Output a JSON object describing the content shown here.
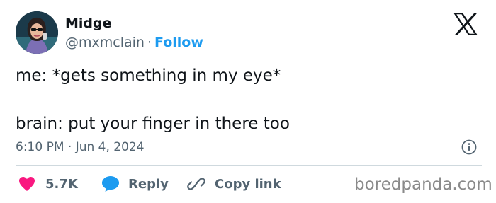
{
  "author": {
    "display_name": "Midge",
    "handle": "@mxmclain",
    "separator": "·",
    "follow_label": "Follow"
  },
  "tweet": {
    "text": "me: *gets something in my eye*\n\nbrain: put your finger in there too",
    "timestamp": "6:10 PM · Jun 4, 2024"
  },
  "actions": {
    "like_count": "5.7K",
    "reply_label": "Reply",
    "copy_link_label": "Copy link"
  },
  "icons": {
    "brand": "x-logo-icon",
    "info": "info-icon",
    "like": "heart-icon",
    "reply": "speech-bubble-icon",
    "copy": "link-icon"
  },
  "colors": {
    "follow": "#1d9bf0",
    "heart": "#f91880",
    "reply_bubble": "#1d9bf0",
    "secondary_text": "#536471"
  },
  "watermark": "boredpanda.com"
}
